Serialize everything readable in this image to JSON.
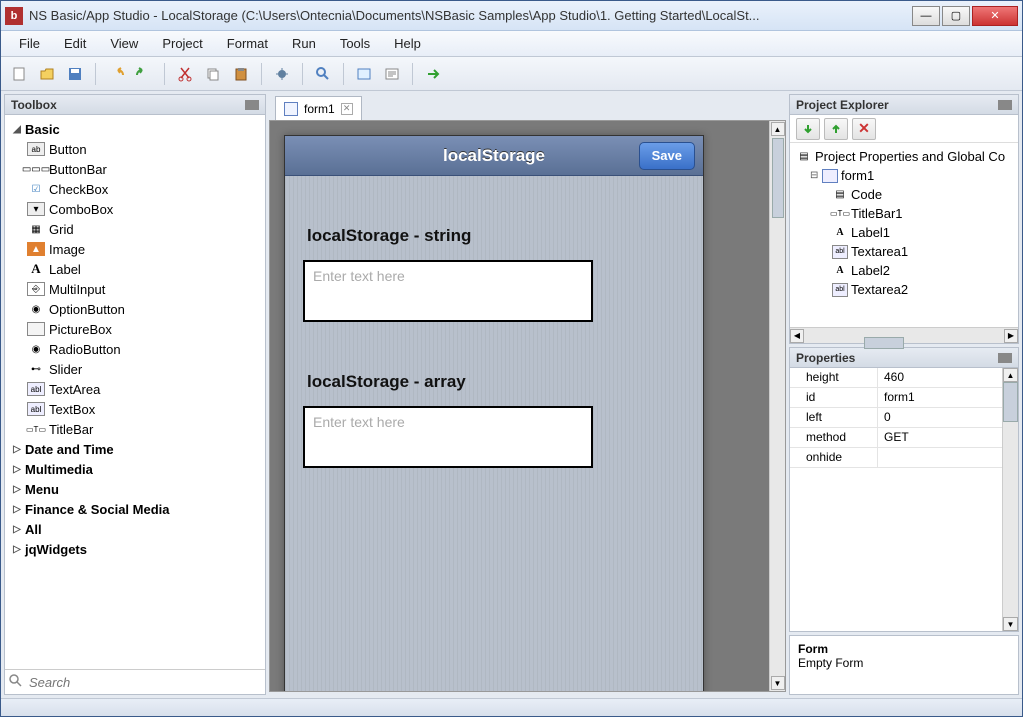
{
  "window": {
    "title": "NS Basic/App Studio - LocalStorage (C:\\Users\\Ontecnia\\Documents\\NSBasic Samples\\App Studio\\1. Getting Started\\LocalSt..."
  },
  "menu": [
    "File",
    "Edit",
    "View",
    "Project",
    "Format",
    "Run",
    "Tools",
    "Help"
  ],
  "toolbox": {
    "title": "Toolbox",
    "groups": [
      {
        "label": "Basic",
        "expanded": true,
        "children": [
          {
            "label": "Button",
            "icon": "ab"
          },
          {
            "label": "ButtonBar",
            "icon": "▭▭▭"
          },
          {
            "label": "CheckBox",
            "icon": "☑"
          },
          {
            "label": "ComboBox",
            "icon": "▾"
          },
          {
            "label": "Grid",
            "icon": "▦"
          },
          {
            "label": "Image",
            "icon": "🖼"
          },
          {
            "label": "Label",
            "icon": "A"
          },
          {
            "label": "MultiInput",
            "icon": "⎆"
          },
          {
            "label": "OptionButton",
            "icon": "◉"
          },
          {
            "label": "PictureBox",
            "icon": "▭"
          },
          {
            "label": "RadioButton",
            "icon": "◉"
          },
          {
            "label": "Slider",
            "icon": "─○─"
          },
          {
            "label": "TextArea",
            "icon": "abl"
          },
          {
            "label": "TextBox",
            "icon": "abl"
          },
          {
            "label": "TitleBar",
            "icon": "▭T▭"
          }
        ]
      },
      {
        "label": "Date and Time",
        "expanded": false
      },
      {
        "label": "Multimedia",
        "expanded": false
      },
      {
        "label": "Menu",
        "expanded": false
      },
      {
        "label": "Finance & Social Media",
        "expanded": false
      },
      {
        "label": "All",
        "expanded": false
      },
      {
        "label": "jqWidgets",
        "expanded": false
      }
    ],
    "search_placeholder": "Search"
  },
  "tab": {
    "label": "form1"
  },
  "phone": {
    "header_title": "localStorage",
    "save_label": "Save",
    "label1": "localStorage - string",
    "ta1_placeholder": "Enter text here",
    "label2": "localStorage - array",
    "ta2_placeholder": "Enter text here"
  },
  "explorer": {
    "title": "Project Explorer",
    "root": "Project Properties and Global Co",
    "form": "form1",
    "children": [
      "Code",
      "TitleBar1",
      "Label1",
      "Textarea1",
      "Label2",
      "Textarea2"
    ],
    "child_icons": [
      "▤",
      "▭T▭",
      "A",
      "abl",
      "A",
      "abl"
    ]
  },
  "properties": {
    "title": "Properties",
    "rows": [
      {
        "k": "height",
        "v": "460"
      },
      {
        "k": "id",
        "v": "form1"
      },
      {
        "k": "left",
        "v": "0"
      },
      {
        "k": "method",
        "v": "GET"
      },
      {
        "k": "onhide",
        "v": ""
      }
    ],
    "desc_title": "Form",
    "desc_text": "Empty Form"
  }
}
